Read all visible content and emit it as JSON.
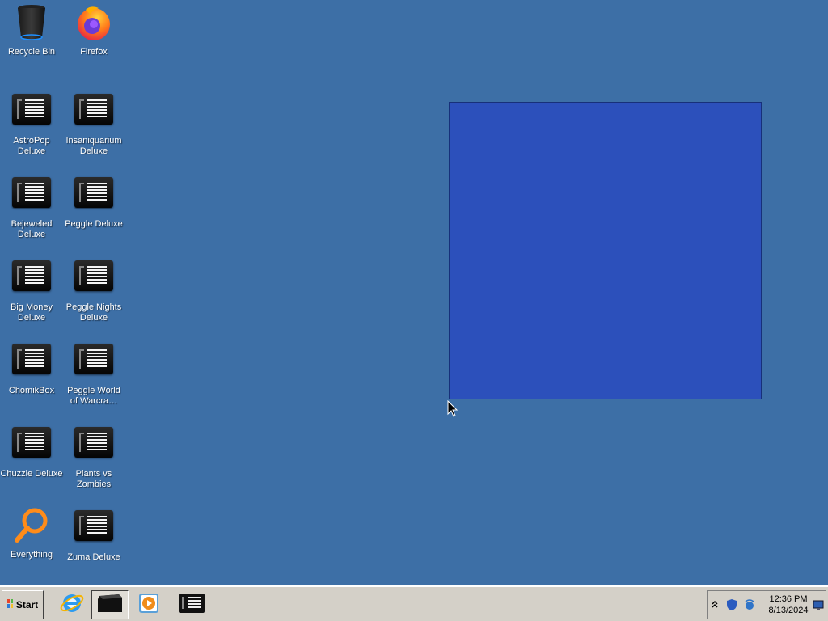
{
  "desktop": {
    "background_color": "#3d6fa6",
    "icons": [
      {
        "id": "recycle-bin",
        "label": "Recycle Bin",
        "icon": "recycle-bin-icon"
      },
      {
        "id": "firefox",
        "label": "Firefox",
        "icon": "firefox-icon"
      },
      {
        "id": "astropop",
        "label": "AstroPop Deluxe",
        "icon": "app-icon"
      },
      {
        "id": "insaniquarium",
        "label": "Insaniquarium Deluxe",
        "icon": "app-icon"
      },
      {
        "id": "bejeweled",
        "label": "Bejeweled Deluxe",
        "icon": "app-icon"
      },
      {
        "id": "peggle",
        "label": "Peggle Deluxe",
        "icon": "app-icon"
      },
      {
        "id": "bigmoney",
        "label": "Big Money Deluxe",
        "icon": "app-icon"
      },
      {
        "id": "peggle-nights",
        "label": "Peggle Nights Deluxe",
        "icon": "app-icon"
      },
      {
        "id": "chomikbox",
        "label": "ChomikBox",
        "icon": "app-icon"
      },
      {
        "id": "peggle-wow",
        "label": "Peggle World of Warcra…",
        "icon": "app-icon"
      },
      {
        "id": "chuzzle",
        "label": "Chuzzle Deluxe",
        "icon": "app-icon"
      },
      {
        "id": "pvz",
        "label": "Plants vs Zombies",
        "icon": "app-icon"
      },
      {
        "id": "everything",
        "label": "Everything",
        "icon": "magnifier-icon"
      },
      {
        "id": "zuma",
        "label": "Zuma Deluxe",
        "icon": "app-icon"
      }
    ]
  },
  "selection_rect": {
    "color": "#2c50bb"
  },
  "taskbar": {
    "start_label": "Start",
    "buttons": [
      {
        "name": "internet-explorer",
        "icon": "ie-icon"
      },
      {
        "name": "active-window",
        "icon": "window-icon",
        "pressed": true
      },
      {
        "name": "media-player",
        "icon": "media-player-icon"
      },
      {
        "name": "app-window",
        "icon": "app-icon"
      }
    ],
    "tray": {
      "time": "12:36 PM",
      "date": "8/13/2024"
    }
  }
}
